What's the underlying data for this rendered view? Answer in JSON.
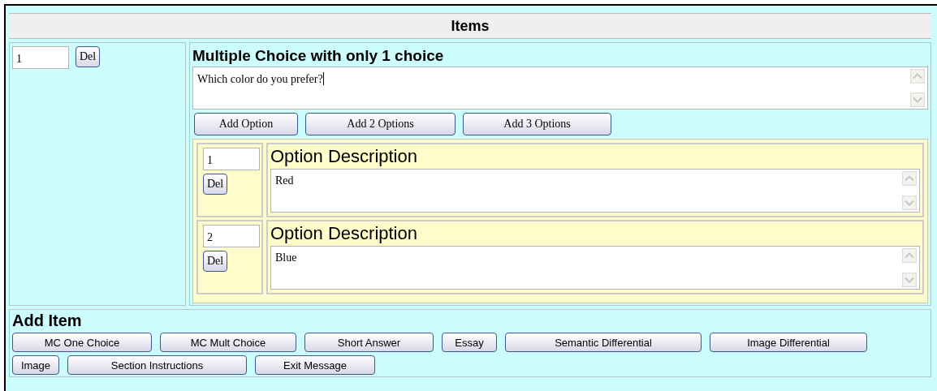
{
  "section_title": "Items",
  "items": [
    {
      "number": "1",
      "delete_button": "Del",
      "type_title": "Multiple Choice with only 1 choice",
      "question": "Which color do you prefer?",
      "add_buttons": [
        "Add Option",
        "Add 2 Options",
        "Add 3 Options"
      ],
      "options": [
        {
          "number": "1",
          "delete_button": "Del",
          "label": "Option Description",
          "value": "Red"
        },
        {
          "number": "2",
          "delete_button": "Del",
          "label": "Option Description",
          "value": "Blue"
        }
      ]
    }
  ],
  "add_item": {
    "title": "Add Item",
    "buttons": [
      "MC One Choice",
      "MC Mult Choice",
      "Short Answer",
      "Essay",
      "Semantic Differential",
      "Image Differential",
      "Image",
      "Section Instructions",
      "Exit Message"
    ]
  }
}
